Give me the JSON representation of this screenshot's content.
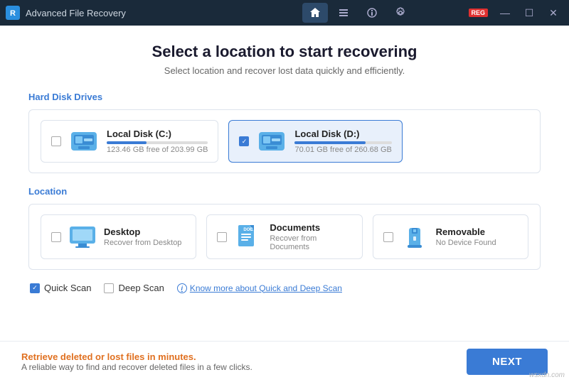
{
  "app": {
    "title": "Advanced File Recovery",
    "nav": [
      {
        "id": "home",
        "label": "🏠",
        "active": true
      },
      {
        "id": "list",
        "label": "≡"
      },
      {
        "id": "info",
        "label": "ℹ"
      },
      {
        "id": "settings",
        "label": "⚙"
      }
    ],
    "controls": {
      "minimize": "—",
      "maximize": "☐",
      "close": "✕"
    }
  },
  "page": {
    "title": "Select a location to start recovering",
    "subtitle": "Select location and recover lost data quickly and efficiently."
  },
  "sections": {
    "hard_disk_label": "Hard Disk Drives",
    "location_label": "Location"
  },
  "drives": [
    {
      "name": "Local Disk (C:)",
      "space": "123.46 GB free of 203.99 GB",
      "selected": false,
      "fill_pct": 39
    },
    {
      "name": "Local Disk (D:)",
      "space": "70.01 GB free of 260.68 GB",
      "selected": true,
      "fill_pct": 73
    }
  ],
  "locations": [
    {
      "name": "Desktop",
      "sub": "Recover from Desktop",
      "type": "desktop"
    },
    {
      "name": "Documents",
      "sub": "Recover from Documents",
      "type": "documents"
    },
    {
      "name": "Removable",
      "sub": "No Device Found",
      "type": "removable"
    }
  ],
  "scan": {
    "quick_label": "Quick Scan",
    "quick_checked": true,
    "deep_label": "Deep Scan",
    "deep_checked": false,
    "link_label": "Know more about Quick and Deep Scan"
  },
  "footer": {
    "promo_line1": "Retrieve deleted or lost files in minutes.",
    "promo_line2": "A reliable way to find and recover deleted files in a few clicks.",
    "next_button": "NEXT"
  },
  "watermark": "wsxdn.com"
}
